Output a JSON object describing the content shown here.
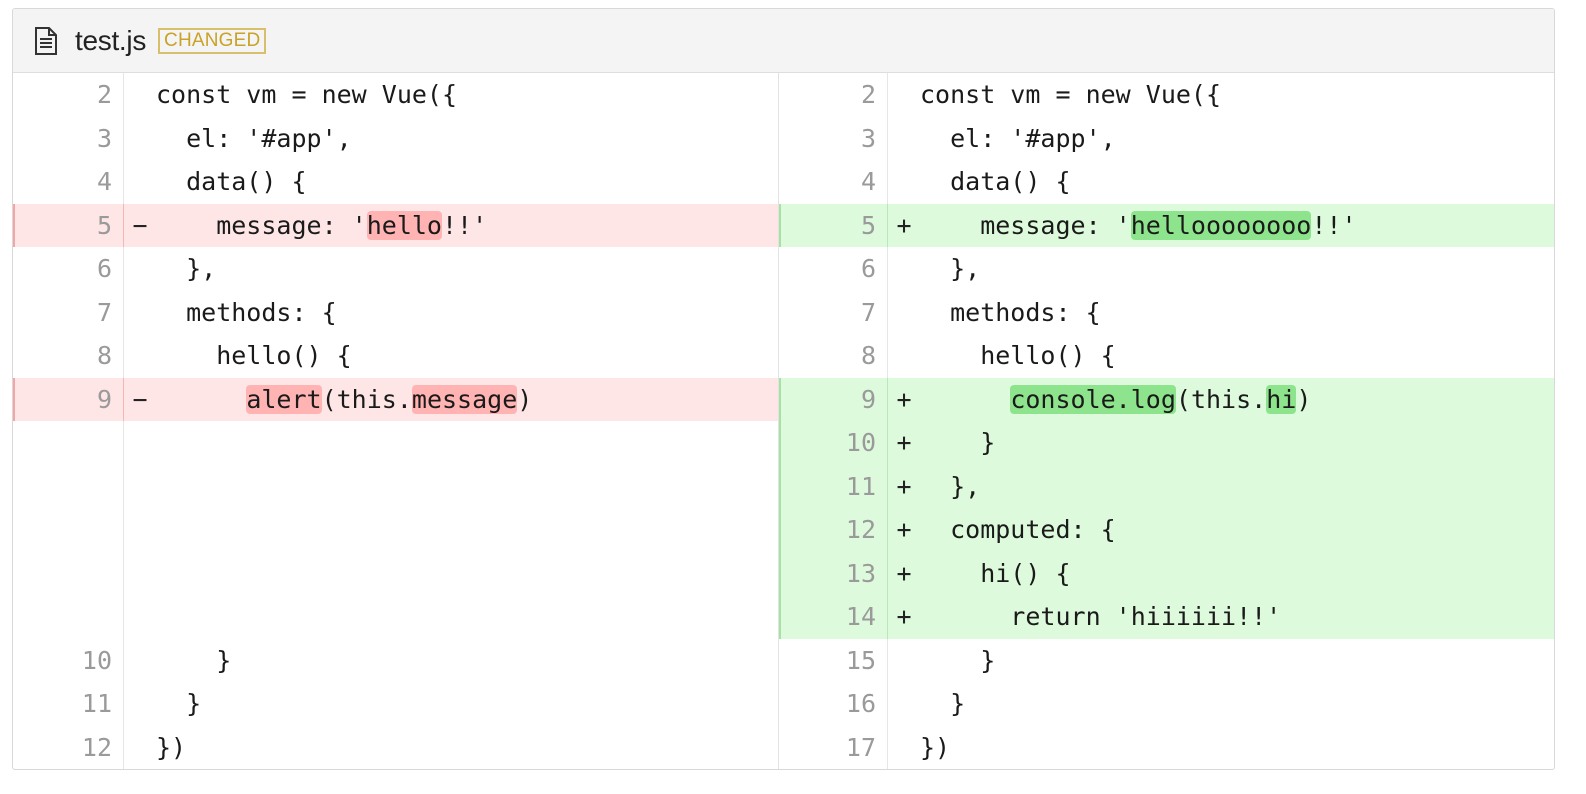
{
  "file": {
    "icon": "file-text-icon",
    "name": "test.js",
    "status_badge": "CHANGED",
    "badge_color": "#c9a227"
  },
  "colors": {
    "deleted_line_bg": "#ffe6e6",
    "deleted_highlight": "#ffb3b3",
    "added_line_bg": "#ddfbdc",
    "added_highlight": "#8ee48c"
  },
  "left": {
    "rows": [
      {
        "num": "2",
        "sign": "",
        "type": "context",
        "parts": [
          {
            "t": "const vm = new Vue({"
          }
        ]
      },
      {
        "num": "3",
        "sign": "",
        "type": "context",
        "parts": [
          {
            "t": "  el: '#app',"
          }
        ]
      },
      {
        "num": "4",
        "sign": "",
        "type": "context",
        "parts": [
          {
            "t": "  data() {"
          }
        ]
      },
      {
        "num": "5",
        "sign": "−",
        "type": "del",
        "parts": [
          {
            "t": "    message: '"
          },
          {
            "t": "hello",
            "hl": true
          },
          {
            "t": "!!'"
          }
        ]
      },
      {
        "num": "6",
        "sign": "",
        "type": "context",
        "parts": [
          {
            "t": "  },"
          }
        ]
      },
      {
        "num": "7",
        "sign": "",
        "type": "context",
        "parts": [
          {
            "t": "  methods: {"
          }
        ]
      },
      {
        "num": "8",
        "sign": "",
        "type": "context",
        "parts": [
          {
            "t": "    hello() {"
          }
        ]
      },
      {
        "num": "9",
        "sign": "−",
        "type": "del",
        "parts": [
          {
            "t": "      "
          },
          {
            "t": "alert",
            "hl": true
          },
          {
            "t": "(this."
          },
          {
            "t": "message",
            "hl": true
          },
          {
            "t": ")"
          }
        ]
      },
      {
        "num": "",
        "sign": "",
        "type": "empty",
        "parts": []
      },
      {
        "num": "",
        "sign": "",
        "type": "empty",
        "parts": []
      },
      {
        "num": "",
        "sign": "",
        "type": "empty",
        "parts": []
      },
      {
        "num": "",
        "sign": "",
        "type": "empty",
        "parts": []
      },
      {
        "num": "",
        "sign": "",
        "type": "empty",
        "parts": []
      },
      {
        "num": "10",
        "sign": "",
        "type": "context",
        "parts": [
          {
            "t": "    }"
          }
        ]
      },
      {
        "num": "11",
        "sign": "",
        "type": "context",
        "parts": [
          {
            "t": "  }"
          }
        ]
      },
      {
        "num": "12",
        "sign": "",
        "type": "context",
        "parts": [
          {
            "t": "})"
          }
        ]
      }
    ]
  },
  "right": {
    "rows": [
      {
        "num": "2",
        "sign": "",
        "type": "context",
        "parts": [
          {
            "t": "const vm = new Vue({"
          }
        ]
      },
      {
        "num": "3",
        "sign": "",
        "type": "context",
        "parts": [
          {
            "t": "  el: '#app',"
          }
        ]
      },
      {
        "num": "4",
        "sign": "",
        "type": "context",
        "parts": [
          {
            "t": "  data() {"
          }
        ]
      },
      {
        "num": "5",
        "sign": "+",
        "type": "add",
        "parts": [
          {
            "t": "    message: '"
          },
          {
            "t": "helloooooooo",
            "hl": true
          },
          {
            "t": "!!'"
          }
        ]
      },
      {
        "num": "6",
        "sign": "",
        "type": "context",
        "parts": [
          {
            "t": "  },"
          }
        ]
      },
      {
        "num": "7",
        "sign": "",
        "type": "context",
        "parts": [
          {
            "t": "  methods: {"
          }
        ]
      },
      {
        "num": "8",
        "sign": "",
        "type": "context",
        "parts": [
          {
            "t": "    hello() {"
          }
        ]
      },
      {
        "num": "9",
        "sign": "+",
        "type": "add",
        "parts": [
          {
            "t": "      "
          },
          {
            "t": "console.log",
            "hl": true
          },
          {
            "t": "(this."
          },
          {
            "t": "hi",
            "hl": true
          },
          {
            "t": ")"
          }
        ]
      },
      {
        "num": "10",
        "sign": "+",
        "type": "add",
        "parts": [
          {
            "t": "    }"
          }
        ]
      },
      {
        "num": "11",
        "sign": "+",
        "type": "add",
        "parts": [
          {
            "t": "  },"
          }
        ]
      },
      {
        "num": "12",
        "sign": "+",
        "type": "add",
        "parts": [
          {
            "t": "  computed: {"
          }
        ]
      },
      {
        "num": "13",
        "sign": "+",
        "type": "add",
        "parts": [
          {
            "t": "    hi() {"
          }
        ]
      },
      {
        "num": "14",
        "sign": "+",
        "type": "add",
        "parts": [
          {
            "t": "      return 'hiiiiii!!'"
          }
        ]
      },
      {
        "num": "15",
        "sign": "",
        "type": "context",
        "parts": [
          {
            "t": "    }"
          }
        ]
      },
      {
        "num": "16",
        "sign": "",
        "type": "context",
        "parts": [
          {
            "t": "  }"
          }
        ]
      },
      {
        "num": "17",
        "sign": "",
        "type": "context",
        "parts": [
          {
            "t": "})"
          }
        ]
      }
    ]
  }
}
